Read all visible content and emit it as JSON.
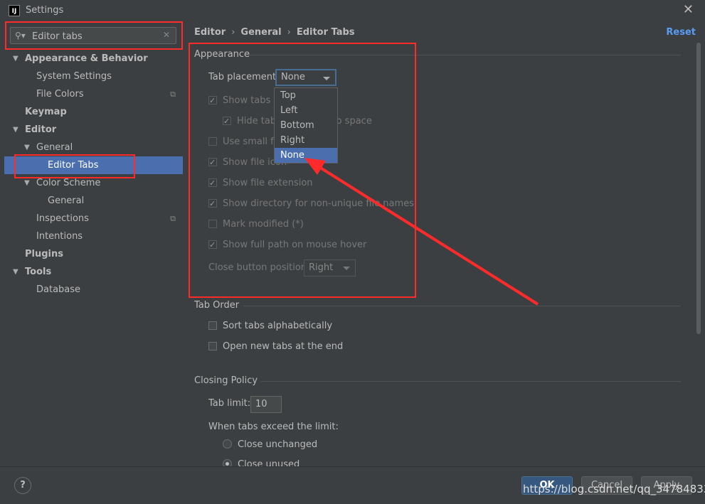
{
  "window": {
    "title": "Settings",
    "app_icon": "IJ"
  },
  "search": {
    "value": "Editor tabs"
  },
  "tree": [
    {
      "label": "Appearance & Behavior",
      "level": 0,
      "arrow": "▼",
      "bold": true
    },
    {
      "label": "System Settings",
      "level": 1
    },
    {
      "label": "File Colors",
      "level": 1,
      "proj": "⧉"
    },
    {
      "label": "Keymap",
      "level": 0,
      "bold": true
    },
    {
      "label": "Editor",
      "level": 0,
      "arrow": "▼",
      "bold": true
    },
    {
      "label": "General",
      "level": 1,
      "arrow": "▼"
    },
    {
      "label": "Editor Tabs",
      "level": 2,
      "selected": true
    },
    {
      "label": "Color Scheme",
      "level": 1,
      "arrow": "▼"
    },
    {
      "label": "General",
      "level": 2
    },
    {
      "label": "Inspections",
      "level": 1,
      "proj": "⧉"
    },
    {
      "label": "Intentions",
      "level": 1
    },
    {
      "label": "Plugins",
      "level": 0,
      "bold": true
    },
    {
      "label": "Tools",
      "level": 0,
      "arrow": "▼",
      "bold": true
    },
    {
      "label": "Database",
      "level": 1
    }
  ],
  "breadcrumb": {
    "a": "Editor",
    "b": "General",
    "c": "Editor Tabs"
  },
  "reset_label": "Reset",
  "appearance": {
    "title": "Appearance",
    "tab_placement_label": "Tab placement:",
    "tab_placement_value": "None",
    "options": [
      {
        "label": "Show tabs in one row",
        "checked": true
      },
      {
        "label": "Hide tabs if there is no space",
        "checked": true
      },
      {
        "label": "Use small font for labels",
        "checked": false
      },
      {
        "label": "Show file icon",
        "checked": true
      },
      {
        "label": "Show file extension",
        "checked": true
      },
      {
        "label": "Show directory for non-unique file names",
        "checked": true
      },
      {
        "label": "Mark modified (*)",
        "checked": false
      },
      {
        "label": "Show full path on mouse hover",
        "checked": true
      }
    ],
    "close_button_label": "Close button position:",
    "close_button_value": "Right"
  },
  "dropdown": [
    "Top",
    "Left",
    "Bottom",
    "Right",
    "None"
  ],
  "tab_order": {
    "title": "Tab Order",
    "options": [
      {
        "label": "Sort tabs alphabetically",
        "checked": false
      },
      {
        "label": "Open new tabs at the end",
        "checked": false
      }
    ]
  },
  "closing": {
    "title": "Closing Policy",
    "tab_limit_label": "Tab limit:",
    "tab_limit_value": "10",
    "exceed_label": "When tabs exceed the limit:",
    "radios": [
      {
        "label": "Close unchanged",
        "checked": false
      },
      {
        "label": "Close unused",
        "checked": true
      }
    ]
  },
  "buttons": {
    "ok": "OK",
    "cancel": "Cancel",
    "apply": "Apply",
    "help": "?"
  },
  "watermark": "https://blog.csdn.net/qq_34784833",
  "annotation_color": "#ff2b2b"
}
